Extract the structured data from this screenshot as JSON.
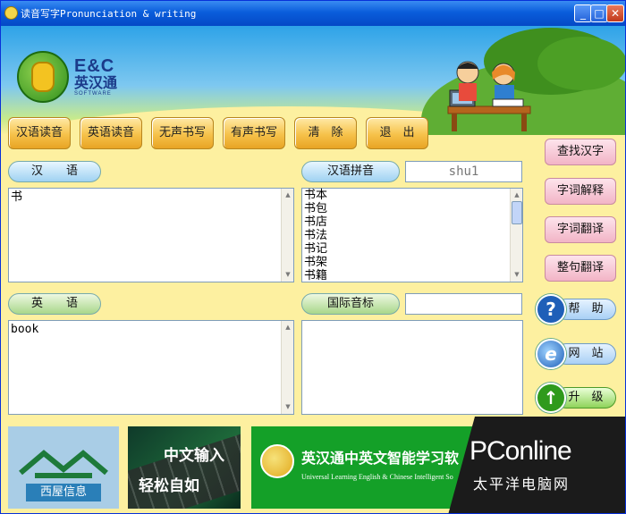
{
  "window": {
    "title": "读音写字Pronunciation & writing",
    "controls": {
      "minimize": "_",
      "maximize": "□",
      "close": "✕"
    }
  },
  "brand": {
    "name": "E&C",
    "subtitle": "英汉通",
    "tagline": "SOFTWARE"
  },
  "toolbar": {
    "buttons": [
      "汉语读音",
      "英语读音",
      "无声书写",
      "有声书写",
      "清　除",
      "退　出"
    ]
  },
  "chinese": {
    "label": "汉　　语",
    "value": "书"
  },
  "pinyin": {
    "label": "汉语拼音",
    "input_value": "shu1",
    "list": [
      "书本",
      "书包",
      "书店",
      "书法",
      "书记",
      "书架",
      "书籍"
    ]
  },
  "english": {
    "label": "英　　语",
    "value": "book"
  },
  "ipa": {
    "label": "国际音标",
    "value": ""
  },
  "side_buttons": [
    "查找汉字",
    "字词解释",
    "字词翻译",
    "整句翻译"
  ],
  "service_buttons": [
    {
      "label": "帮　助",
      "icon": "question-icon",
      "glyph": "?"
    },
    {
      "label": "网　站",
      "icon": "globe-icon",
      "glyph": "e"
    },
    {
      "label": "升　级",
      "icon": "upgrade-arrow-icon",
      "glyph": "↑"
    }
  ],
  "ads": {
    "ad1_text": "西屋信息",
    "ad2_line1": "中文输入",
    "ad2_line2": "轻松自如",
    "ad3_title": "英汉通中英文智能学习软",
    "ad3_subtitle": "Universal  Learning English & Chinese Intelligent So"
  },
  "watermark": {
    "text": "PConline",
    "sub": "太平洋电脑网"
  },
  "colors": {
    "title_bar": "#0a5ddb",
    "body_bg": "#fdf0a0",
    "toolbar_btn": "#f6c24a",
    "side_btn": "#f2b4c6"
  }
}
